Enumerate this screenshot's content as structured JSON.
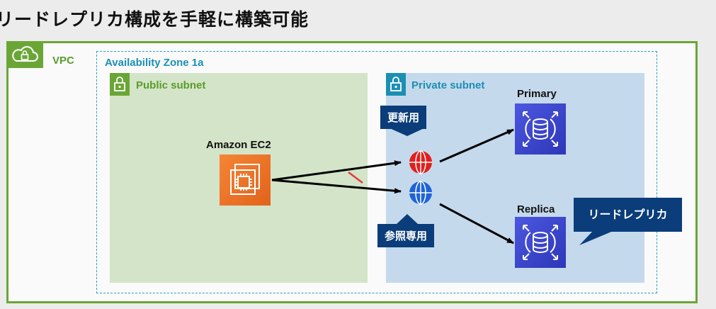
{
  "title": "リードレプリカ構成を手軽に構築可能",
  "vpc": {
    "label": "VPC"
  },
  "availability_zone": {
    "label": "Availability Zone 1a"
  },
  "public_subnet": {
    "label": "Public subnet",
    "ec2": {
      "label": "Amazon EC2"
    }
  },
  "private_subnet": {
    "label": "Private subnet",
    "primary": {
      "label": "Primary"
    },
    "replica": {
      "label": "Replica"
    }
  },
  "endpoints": {
    "write_tag": "更新用",
    "read_tag": "参照専用"
  },
  "callout": {
    "text": "リードレプリカ"
  },
  "colors": {
    "vpc_green": "#6aa636",
    "az_blue": "#2a9fbf",
    "public_bg": "#d3e4c8",
    "private_bg": "#c5d9ec",
    "ec2_orange": "#f58536",
    "rds_blue": "#3b48cc",
    "tag_navy": "#0a3d7a",
    "endpoint_red": "#e0201f",
    "endpoint_blue": "#1f63d6"
  }
}
